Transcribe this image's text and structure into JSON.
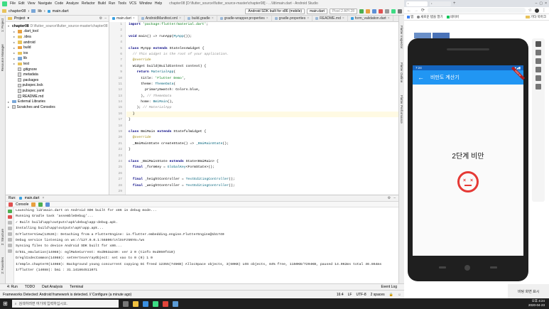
{
  "menu": {
    "items": [
      "File",
      "Edit",
      "View",
      "Navigate",
      "Code",
      "Analyze",
      "Refactor",
      "Build",
      "Run",
      "Tools",
      "VCS",
      "Window",
      "Help"
    ],
    "window_title": "chapter08 [D:\\flutter_source\\flutter_source-master\\chapter08] - ...\\lib\\main.dart - Android Studio"
  },
  "toolbar": {
    "breadcrumbs": [
      "chapter08",
      "lib",
      "main.dart"
    ],
    "device": "Android SDK built for x86 (mobile)",
    "run_config": "main.dart",
    "pixel": "Pixel 2 API 28"
  },
  "left_strip": [
    "1: Project",
    "Resource Manager"
  ],
  "left_strip_bottom": [
    "2: Structure",
    "2: Favorites",
    "Build Variants"
  ],
  "right_strip": [
    "Flutter Inspector",
    "Flutter Outline",
    "Flutter Performance"
  ],
  "project": {
    "header": "Project",
    "root": "chapter08",
    "root_path": "D:\\flutter_source\\flutter_source-master\\chapter08",
    "items": [
      {
        "name": ".dart_tool",
        "kind": "folder-orange",
        "depth": 1
      },
      {
        "name": ".idea",
        "kind": "folder",
        "depth": 1
      },
      {
        "name": "android",
        "kind": "folder",
        "depth": 1
      },
      {
        "name": "build",
        "kind": "folder-orange",
        "depth": 1
      },
      {
        "name": "ios",
        "kind": "folder",
        "depth": 1
      },
      {
        "name": "lib",
        "kind": "folder-blue",
        "depth": 1
      },
      {
        "name": "test",
        "kind": "folder",
        "depth": 1
      },
      {
        "name": ".gitignore",
        "kind": "file",
        "depth": 1
      },
      {
        "name": ".metadata",
        "kind": "file",
        "depth": 1
      },
      {
        "name": ".packages",
        "kind": "file",
        "depth": 1
      },
      {
        "name": "pubspec.lock",
        "kind": "file",
        "depth": 1
      },
      {
        "name": "pubspec.yaml",
        "kind": "file",
        "depth": 1
      },
      {
        "name": "README.md",
        "kind": "file",
        "depth": 1
      },
      {
        "name": "External Libraries",
        "kind": "lib",
        "depth": 0
      },
      {
        "name": "Scratches and Consoles",
        "kind": "scratch",
        "depth": 0
      }
    ]
  },
  "editor": {
    "tabs": [
      "main.dart",
      "AndroidManifest.xml",
      "build.gradle",
      "gradle-wrapper.properties",
      "gradle.properties",
      "README.md",
      "form_validation.dart"
    ],
    "lines": [
      {
        "n": "1",
        "html": "<span class=\"kw\">import</span> <span class=\"str\">'package:flutter/material.dart'</span>;"
      },
      {
        "n": "2",
        "html": ""
      },
      {
        "n": "3",
        "html": "<span class=\"kw\">void</span> main() => runApp(<span class=\"cls\">MyApp</span>());"
      },
      {
        "n": "4",
        "html": ""
      },
      {
        "n": "5",
        "html": "<span class=\"kw\">class</span> MyApp <span class=\"kw\">extends</span> StatelessWidget {"
      },
      {
        "n": "6",
        "html": "  <span class=\"cm\">// This widget is the root of your application.</span>"
      },
      {
        "n": "7",
        "html": "  <span class=\"ann\">@override</span>"
      },
      {
        "n": "8",
        "html": "  Widget build(BuildContext context) {"
      },
      {
        "n": "9",
        "html": "    <span class=\"kw\">return</span> <span class=\"cls\">MaterialApp</span>("
      },
      {
        "n": "10",
        "html": "      title: <span class=\"str\">'Flutter Demo'</span>,"
      },
      {
        "n": "11",
        "html": "      theme: <span class=\"cls\">ThemeData</span>("
      },
      {
        "n": "12",
        "html": "        primarySwatch: Colors.blue,"
      },
      {
        "n": "13",
        "html": "      ), <span class=\"cm\">// ThemeData</span>"
      },
      {
        "n": "14",
        "html": "      home: <span class=\"cls\">BmiMain</span>(),"
      },
      {
        "n": "15",
        "html": "    ); <span class=\"cm\">// MaterialApp</span>"
      },
      {
        "n": "16",
        "html": "  }",
        "hl": true
      },
      {
        "n": "17",
        "html": "}"
      },
      {
        "n": "18",
        "html": ""
      },
      {
        "n": "19",
        "html": "<span class=\"kw\">class</span> BmiMain <span class=\"kw\">extends</span> StatefulWidget {"
      },
      {
        "n": "20",
        "html": "  <span class=\"ann\">@override</span>"
      },
      {
        "n": "21",
        "html": "  _BmiMainState createState() => <span class=\"cls\">_BmiMainState</span>();"
      },
      {
        "n": "22",
        "html": "}"
      },
      {
        "n": "23",
        "html": ""
      },
      {
        "n": "24",
        "html": "<span class=\"kw\">class</span> _BmiMainState <span class=\"kw\">extends</span> State&lt;BmiMain&gt; {"
      },
      {
        "n": "25",
        "html": "  <span class=\"kw\">final</span> _formKey = <span class=\"cls\">GlobalKey</span>&lt;FormState&gt;();"
      },
      {
        "n": "26",
        "html": ""
      },
      {
        "n": "27",
        "html": "  <span class=\"kw\">final</span> _heightController = <span class=\"cls\">TextEditingController</span>();"
      },
      {
        "n": "28",
        "html": "  <span class=\"kw\">final</span> _weightController = <span class=\"cls\">TextEditingController</span>();"
      },
      {
        "n": "29",
        "html": ""
      },
      {
        "n": "30",
        "html": "  <span class=\"ann\">@override</span>"
      }
    ]
  },
  "run": {
    "label": "Run:",
    "config": "main.dart",
    "console_tab": "Console",
    "log": [
      "Launching lib\\main.dart on Android SDK built for x86 in debug mode...",
      "Running Gradle task 'assembleDebug'...",
      "✓ Built build\\app\\outputs\\apk\\debug\\app-debug.apk.",
      "Installing build\\app\\outputs\\apk\\app.apk...",
      "D/FlutterView(13536): Detaching from a FlutterEngine: io.flutter.embedding.engine.FlutterEngine@1b1740",
      "Debug service listening on ws://127.0.0.1:56800/cAlXnFz5NY8=/ws",
      "Syncing files to device Android SDK built for x86...",
      "D/EGL_emulation(14088): eglMakeCurrent: 0xd053a240: ver 2 0 (tinfo 0xd059f410)",
      "D/eglCodecCommon(14088): setVertexArrayObject: set vao to 0 (0) 1 0",
      "I/emple.chapter0(14088): Background young concurrent copying GC freed 12355(745KB) AllocSpace objects, 3(60KB) LOS objects, 84% free, 1150KB/7294KB, paused 14.062ms total 46.864ms",
      "I/flutter (14088): bmi : 31.141864511071"
    ]
  },
  "bottom_tabs": [
    "4: Run",
    "TODO",
    "Dart Analysis",
    "Terminal"
  ],
  "event_log": "Event Log",
  "status": {
    "message": "Frameworks Detected: Android framework is detected. // Configure (a minute ago)",
    "position": "16:4",
    "line_sep": "LF",
    "encoding": "UTF-8",
    "indent": "2 spaces"
  },
  "browser": {
    "tabs": [
      "•",
      "•",
      "•"
    ],
    "bookmarks": [
      "앱",
      "새로운 탭을 열기",
      "네이버",
      "기타 북마크"
    ]
  },
  "phone": {
    "time": "7:24",
    "app_title": "비만도 계산기",
    "result": "2단계 비만",
    "debug": "DEBUG"
  },
  "taskbar": {
    "search_placeholder": "검색하려면 여기에 입력하십시오.",
    "time": "오후 4:24",
    "date": "2020-04-23"
  },
  "notification": "바탕 화면 표시",
  "colors": {
    "app_bar": "#2196f3",
    "status": "#1565c0",
    "sad_face": "#e53935",
    "android": "#3ddc84"
  }
}
